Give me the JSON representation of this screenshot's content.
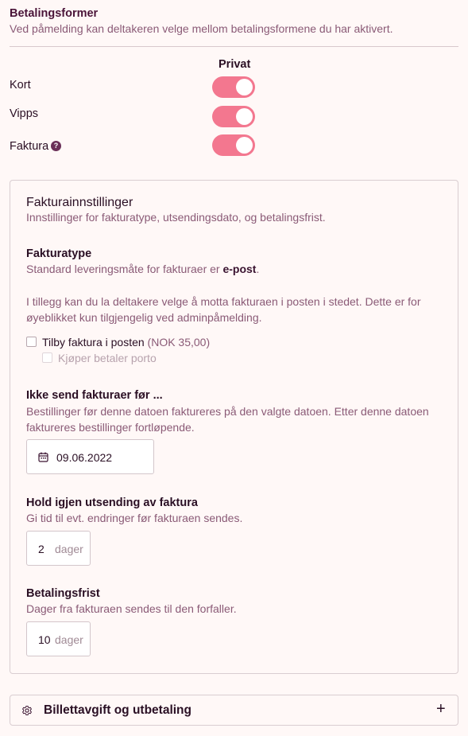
{
  "payment": {
    "title": "Betalingsformer",
    "subtitle": "Ved påmelding kan deltakeren velge mellom betalingsformene du har aktivert.",
    "column_header": "Privat",
    "methods": [
      {
        "label": "Kort",
        "enabled": true
      },
      {
        "label": "Vipps",
        "enabled": true
      },
      {
        "label": "Faktura",
        "enabled": true,
        "help": "?"
      }
    ]
  },
  "invoice_settings": {
    "title": "Fakturainnstillinger",
    "subtitle": "Innstillinger for fakturatype, utsendingsdato, og betalingsfrist.",
    "type": {
      "title": "Fakturatype",
      "desc_prefix": "Standard leveringsmåte for fakturaer er ",
      "desc_bold": "e-post",
      "desc_suffix": ".",
      "info_line1": "I tillegg kan du la deltakere velge å motta fakturaen i posten i stedet. Dette er for",
      "info_line2": "øyeblikket kun tilgjengelig ved adminpåmelding.",
      "offer_post_label": "Tilby faktura i posten",
      "offer_post_price": "(NOK 35,00)",
      "buyer_pays_label": "Kjøper betaler porto"
    },
    "not_before": {
      "title": "Ikke send fakturaer før ...",
      "desc_line1": "Bestillinger før denne datoen faktureres på den valgte datoen. Etter denne datoen",
      "desc_line2": "faktureres bestillinger fortløpende.",
      "date": "09.06.2022"
    },
    "hold": {
      "title": "Hold igjen utsending av faktura",
      "desc": "Gi tid til evt. endringer før fakturaen sendes.",
      "value": "2",
      "unit": "dager"
    },
    "due": {
      "title": "Betalingsfrist",
      "desc": "Dager fra fakturaen sendes til den forfaller.",
      "value": "10",
      "unit": "dager"
    }
  },
  "ticket_fee": {
    "title": "Billettavgift og utbetaling",
    "expand": "+"
  },
  "colors": {
    "toggle_on": "#f3778f",
    "accent": "#4a1438"
  }
}
